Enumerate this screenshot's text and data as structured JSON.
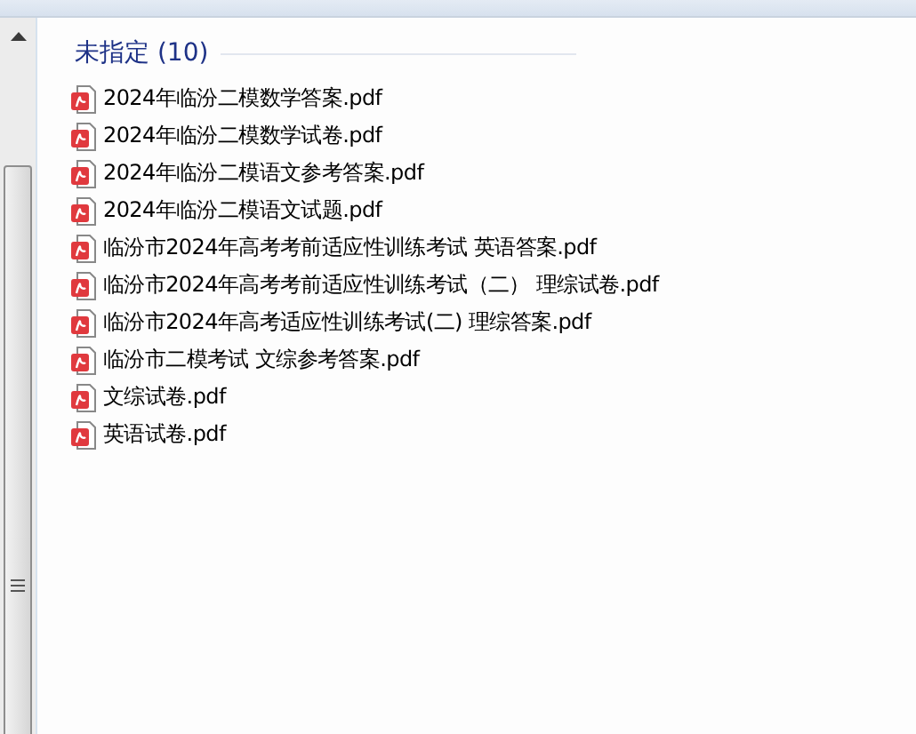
{
  "group": {
    "title": "未指定 (10)"
  },
  "files": [
    {
      "name": "2024年临汾二模数学答案.pdf"
    },
    {
      "name": "2024年临汾二模数学试卷.pdf"
    },
    {
      "name": "2024年临汾二模语文参考答案.pdf"
    },
    {
      "name": "2024年临汾二模语文试题.pdf"
    },
    {
      "name": "临汾市2024年高考考前适应性训练考试 英语答案.pdf"
    },
    {
      "name": "临汾市2024年高考考前适应性训练考试（二） 理综试卷.pdf"
    },
    {
      "name": "临汾市2024年高考适应性训练考试(二) 理综答案.pdf"
    },
    {
      "name": "临汾市二模考试 文综参考答案.pdf"
    },
    {
      "name": "文综试卷.pdf"
    },
    {
      "name": "英语试卷.pdf"
    }
  ]
}
